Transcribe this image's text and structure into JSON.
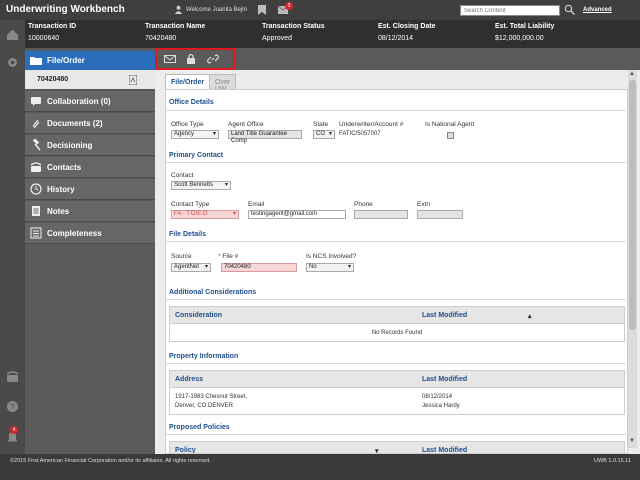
{
  "app": {
    "title": "Underwriting Workbench",
    "welcome": "Welcome Juanita Bejin",
    "mail_count": "3",
    "search_placeholder": "Search Content",
    "advanced_label": "Advanced",
    "bell_count": "4"
  },
  "summary": {
    "columns": [
      {
        "label": "Transaction ID",
        "value": "10000640"
      },
      {
        "label": "Transaction Name",
        "value": "70420480"
      },
      {
        "label": "Transaction Status",
        "value": "Approved"
      },
      {
        "label": "Est. Closing Date",
        "value": "08/12/2014"
      },
      {
        "label": "Est. Total Liability",
        "value": "$12,000,000.00"
      }
    ]
  },
  "nav": {
    "file_order": "File/Order",
    "file_number": "70420480",
    "items": [
      {
        "label": "Collaboration (0)",
        "icon": "collaboration-icon"
      },
      {
        "label": "Documents (2)",
        "icon": "paperclip-icon"
      },
      {
        "label": "Decisioning",
        "icon": "gavel-icon"
      },
      {
        "label": "Contacts",
        "icon": "phone-icon"
      },
      {
        "label": "History",
        "icon": "clock-icon"
      },
      {
        "label": "Notes",
        "icon": "notes-icon"
      },
      {
        "label": "Completeness",
        "icon": "checklist-icon"
      }
    ]
  },
  "toolbar": {
    "icons": [
      "email-icon",
      "lock-icon",
      "link-icon"
    ]
  },
  "tabs": [
    "File/Order",
    "Over UW Limit"
  ],
  "office_details": {
    "title": "Office Details",
    "office_type_label": "Office Type",
    "office_type_value": "Agency",
    "agent_office_label": "Agent Office",
    "agent_office_value": "Land Title Guarantee Comp",
    "state_label": "State",
    "state_value": "CO",
    "underwriter_label": "Underwriter/Account #",
    "underwriter_value": "FATIC/5057007",
    "national_agent_label": "Is National Agent"
  },
  "primary_contact": {
    "title": "Primary Contact",
    "contact_label": "Contact",
    "contact_value": "Scott Bennetts",
    "contact_type_label": "Contact Type",
    "contact_type_value": "FA - T.O/E.O",
    "email_label": "Email",
    "email_value": "testingagent@gmail.com",
    "phone_label": "Phone",
    "extn_label": "Extn"
  },
  "file_details": {
    "title": "File Details",
    "source_label": "Source",
    "source_value": "AgentNet",
    "file_label": "File #",
    "file_value": "70420480",
    "ncs_label": "Is NCS Involved?",
    "ncs_value": "No"
  },
  "additional_considerations": {
    "title": "Additional Considerations",
    "headers": [
      "Consideration",
      "Last Modified"
    ],
    "empty_text": "No Records Found"
  },
  "property_information": {
    "title": "Property Information",
    "headers": [
      "Address",
      "Last Modified"
    ],
    "address_line1": "1917-1983 Chesnut Street,",
    "address_line2": "Denver, CO DENVER",
    "modified_date": "08/12/2014",
    "modified_by": "Jessica Hardy"
  },
  "proposed_policies": {
    "title": "Proposed Policies",
    "headers": [
      "Policy",
      "Last Modified"
    ]
  },
  "footer": {
    "copyright": "©2015 First American Financial Corporation and/or its affiliates. All rights reserved.",
    "version": "UWB 1.0.15.11"
  },
  "colors": {
    "accent": "#2a6ebb",
    "section_title": "#1f4e8c",
    "highlight": "#e0191f",
    "badge": "#d9262c"
  }
}
